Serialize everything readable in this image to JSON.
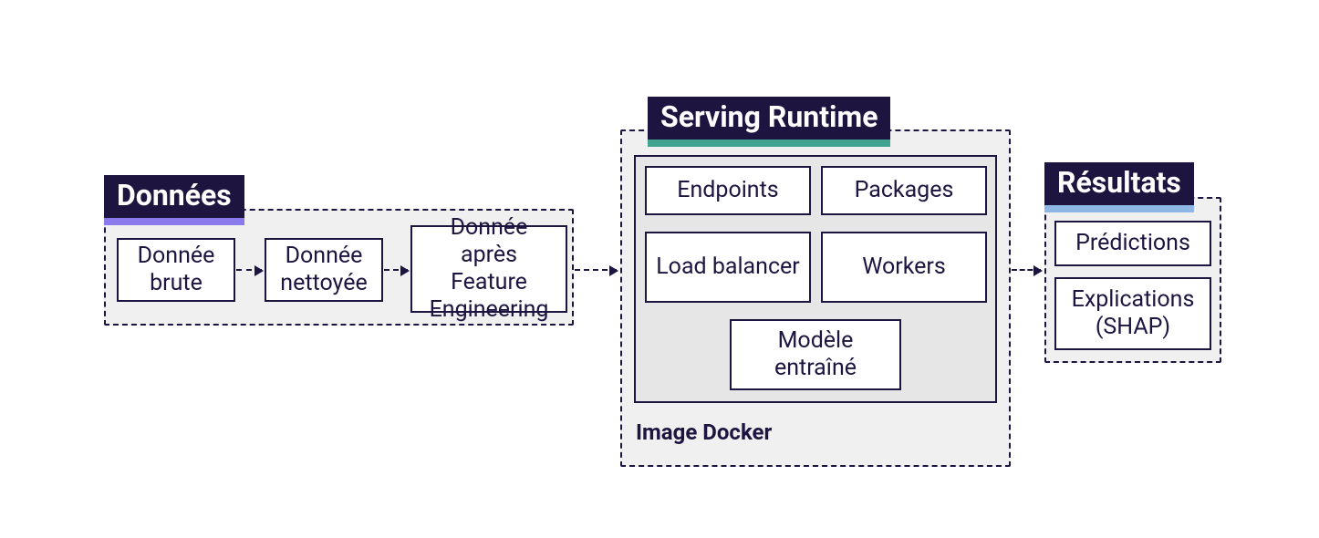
{
  "groups": {
    "data": {
      "title": "Données",
      "accent": "#8a7bed",
      "boxes": [
        "Donnée brute",
        "Donnée nettoyée",
        "Donnée après Feature Engineering"
      ]
    },
    "runtime": {
      "title": "Serving Runtime",
      "accent": "#3fa38f",
      "inner_caption": "Image Docker",
      "boxes": [
        "Endpoints",
        "Packages",
        "Load balancer",
        "Workers",
        "Modèle entraîné"
      ]
    },
    "results": {
      "title": "Résultats",
      "accent": "#8fb7e6",
      "boxes": [
        "Prédictions",
        "Explications (SHAP)"
      ]
    }
  }
}
